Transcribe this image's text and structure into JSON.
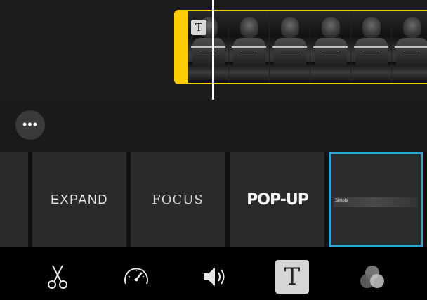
{
  "timeline": {
    "clip_badge_glyph": "T",
    "frame_count": 6
  },
  "more_button": {
    "glyph": "•••"
  },
  "title_styles": [
    {
      "label": ""
    },
    {
      "label": "EXPAND"
    },
    {
      "label": "FOCUS"
    },
    {
      "label": "POP-UP"
    },
    {
      "label": "Simple",
      "selected": true
    }
  ],
  "toolbar": {
    "tools": [
      "scissors-icon",
      "speedometer-icon",
      "volume-icon",
      "titles-icon",
      "filters-icon"
    ],
    "titles_glyph": "T",
    "active_tool": "titles"
  },
  "colors": {
    "clip_border": "#ffcc00",
    "selection": "#2aa7e0",
    "background": "#000000"
  }
}
